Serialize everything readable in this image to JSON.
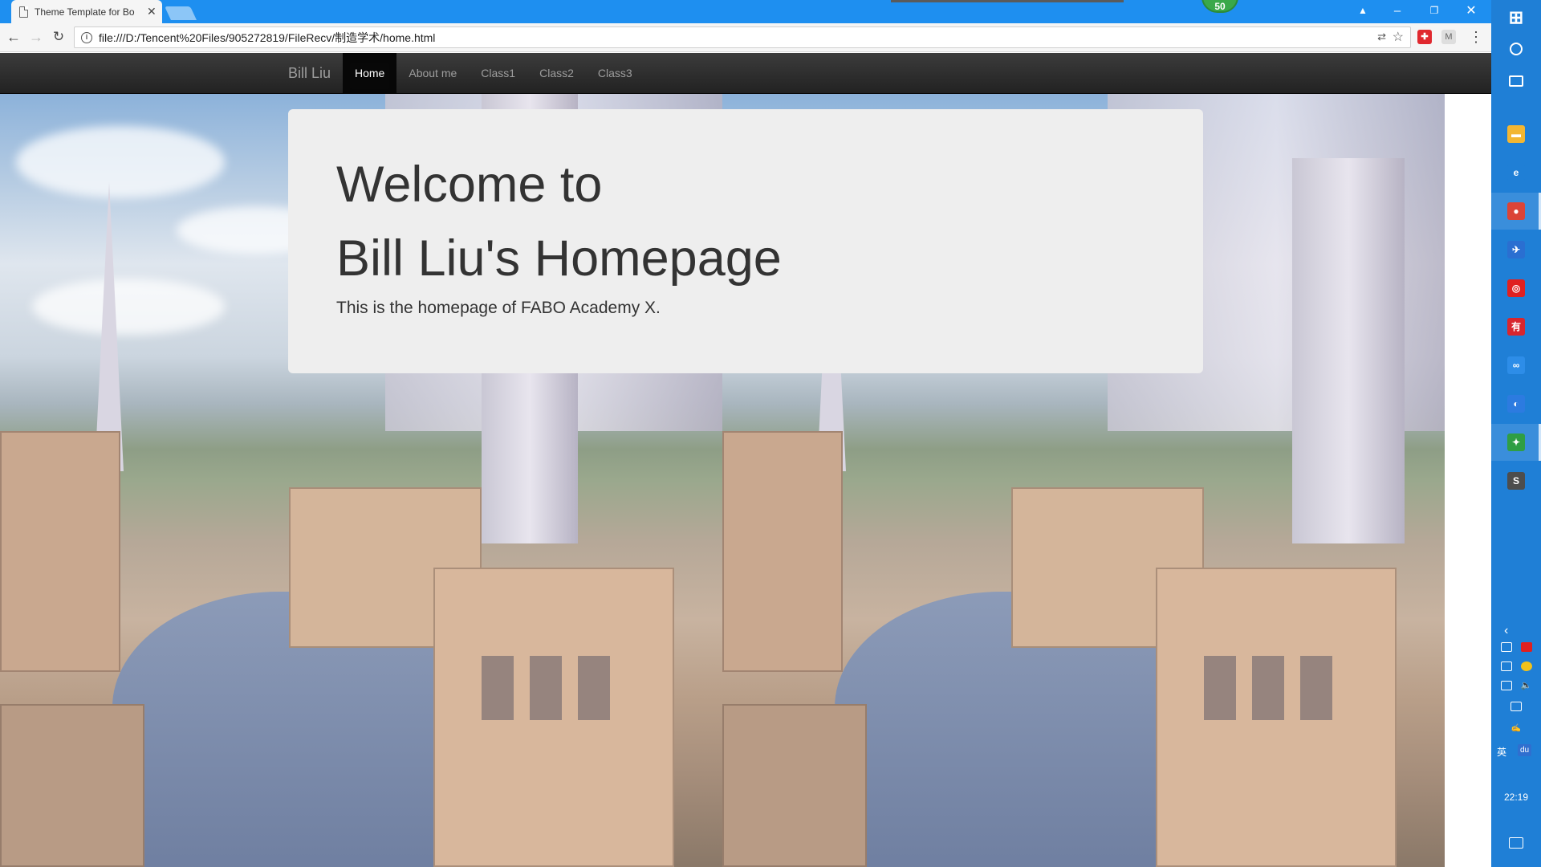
{
  "browser": {
    "tab_title": "Theme Template for Bo",
    "address": "file:///D:/Tencent%20Files/905272819/FileRecv/制造学术/home.html",
    "badge_count": "50"
  },
  "site": {
    "brand": "Bill Liu",
    "nav": [
      {
        "label": "Home",
        "active": true
      },
      {
        "label": "About me",
        "active": false
      },
      {
        "label": "Class1",
        "active": false
      },
      {
        "label": "Class2",
        "active": false
      },
      {
        "label": "Class3",
        "active": false
      }
    ],
    "jumbotron": {
      "heading_line1": "Welcome to",
      "heading_line2": "Bill Liu's Homepage",
      "text": "This is the homepage of FABO Academy X."
    }
  },
  "taskbar": {
    "apps": [
      {
        "name": "file-explorer-icon",
        "glyph": "▬",
        "color": "#f2b632"
      },
      {
        "name": "ie-icon",
        "glyph": "e",
        "color": "#1f7fd6"
      },
      {
        "name": "chrome-icon",
        "glyph": "●",
        "color": "#db4437"
      },
      {
        "name": "mail-icon",
        "glyph": "✈",
        "color": "#2a6fd1"
      },
      {
        "name": "netease-music-icon",
        "glyph": "◎",
        "color": "#e02020"
      },
      {
        "name": "youdao-icon",
        "glyph": "有",
        "color": "#d8262e"
      },
      {
        "name": "baidu-netdisk-icon",
        "glyph": "∞",
        "color": "#2d8de8"
      },
      {
        "name": "qq-browser-icon",
        "glyph": "◐",
        "color": "#2c7be0"
      },
      {
        "name": "game-icon",
        "glyph": "✦",
        "color": "#2f9e44"
      },
      {
        "name": "sublime-icon",
        "glyph": "S",
        "color": "#4d4d4d"
      }
    ],
    "ime": "英",
    "du": "du",
    "time": "22:19"
  },
  "colors": {
    "tabbar": "#1e8ff0",
    "navbar": "#222222",
    "jumbotron": "#eeeeee",
    "taskbar": "#1f7fd6"
  }
}
